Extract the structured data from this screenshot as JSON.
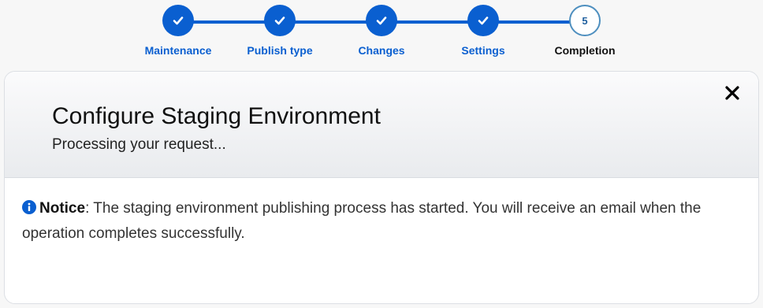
{
  "stepper": {
    "steps": [
      {
        "label": "Maintenance",
        "status": "complete",
        "icon": "check-icon"
      },
      {
        "label": "Publish type",
        "status": "complete",
        "icon": "check-icon"
      },
      {
        "label": "Changes",
        "status": "complete",
        "icon": "check-icon"
      },
      {
        "label": "Settings",
        "status": "complete",
        "icon": "check-icon"
      },
      {
        "label": "Completion",
        "status": "current",
        "number": "5"
      }
    ],
    "accent_color": "#0a5fd0"
  },
  "dialog": {
    "title": "Configure Staging Environment",
    "subtitle": "Processing your request...",
    "close_icon": "close-icon",
    "notice": {
      "icon": "info-icon",
      "label": "Notice",
      "text": ": The staging environment publishing process has started. You will receive an email when the operation completes successfully."
    }
  }
}
